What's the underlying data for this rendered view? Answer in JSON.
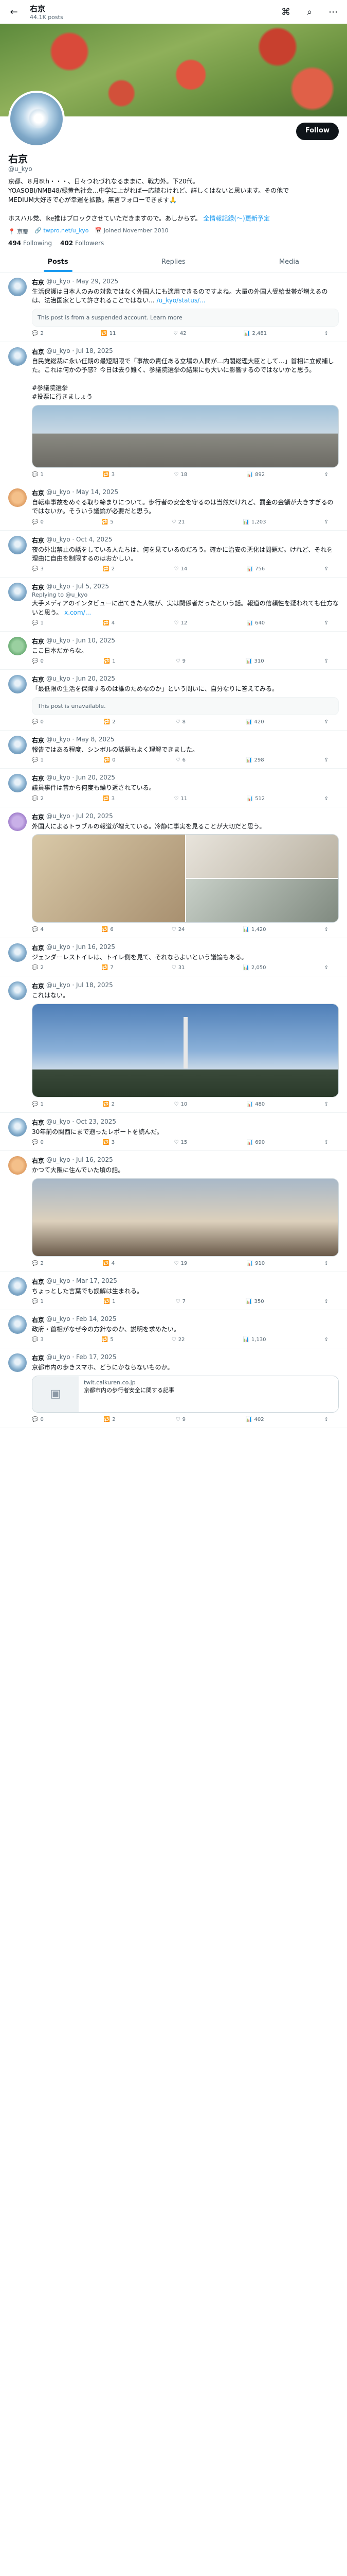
{
  "header": {
    "name": "右京",
    "post_count": "44.1K posts"
  },
  "profile": {
    "name": "右京",
    "handle": "@u_kyo",
    "follow_label": "Follow",
    "bio": "京都、８月8th・・・、日々つれづれなるままに、戦力外。下20代。\nYOASOBI/NMB48/緑黄色社会…中学に上がれば一応読むけれど、詳しくはないと思います。その他で\nMEDIUM大好きで心が幸運を拡散。無言フォローできます🙏\n\nホスハル党、Ike推はブロックさせていただきますので。あしからず。",
    "bio_link": "全情報記録(〜)更新予定",
    "location": "京都",
    "website": "twpro.net/u_kyo",
    "joined": "Joined November 2010",
    "following": "494",
    "following_label": "Following",
    "followers": "402",
    "followers_label": "Followers"
  },
  "tabs": [
    "Posts",
    "Replies",
    "Media"
  ],
  "posts": [
    {
      "name": "右京",
      "handle": "@u_kyo · May 29, 2025",
      "reply_to": "",
      "text": "生活保護は日本人のみの対象ではなく外国人にも適用できるのですよね。大量の外国人受給世帯が増えるのは、法治国家として許されることではない...",
      "link": "/u_kyo/status/...",
      "unavailable": "This post is from a suspended account. Learn more",
      "replies": "2",
      "reposts": "11",
      "likes": "42",
      "views": "2,481"
    },
    {
      "name": "右京",
      "handle": "@u_kyo · Jul 18, 2025",
      "reply_to": "",
      "text": "自民党総裁に永い任期の最短期限で「事故の責任ある立場の人間が…内閣総理大臣として…」首相に立候補した。これは何かの予感？今日は去り難く、参議院選挙の結果にも大いに影響するのではないかと思う。\n\n#参議院選挙\n#投票に行きましょう",
      "link": "",
      "unavailable": "",
      "replies": "1",
      "reposts": "3",
      "likes": "18",
      "views": "892"
    },
    {
      "name": "右京",
      "handle": "@u_kyo · May 14, 2025",
      "reply_to": "",
      "text": "自転車事故をめぐる取り締まりについて。歩行者の安全を守るのは当然だけれど、罰金の金額が大きすぎるのではないか。そういう議論が必要だと思う。",
      "link": "",
      "unavailable": "",
      "replies": "0",
      "reposts": "5",
      "likes": "21",
      "views": "1,203"
    },
    {
      "name": "右京",
      "handle": "@u_kyo · Oct 4, 2025",
      "reply_to": "",
      "text": "夜の外出禁止の話をしている人たちは、何を見ているのだろう。確かに治安の悪化は問題だ。けれど、それを理由に自由を制限するのはおかしい。",
      "link": "",
      "unavailable": "",
      "replies": "3",
      "reposts": "2",
      "likes": "14",
      "views": "756"
    },
    {
      "name": "右京",
      "handle": "@u_kyo · Jul 5, 2025",
      "reply_to": "Replying to @u_kyo",
      "text": "大手メディアのインタビューに出てきた人物が、実は関係者だったという話。報道の信頼性を疑われても仕方ないと思う。",
      "link": "x.com/...",
      "unavailable": "",
      "replies": "1",
      "reposts": "4",
      "likes": "12",
      "views": "640"
    },
    {
      "name": "右京",
      "handle": "@u_kyo · Jun 10, 2025",
      "reply_to": "",
      "text": "ここ日本だからな。",
      "link": "",
      "unavailable": "",
      "replies": "0",
      "reposts": "1",
      "likes": "9",
      "views": "310"
    },
    {
      "name": "右京",
      "handle": "@u_kyo · Jun 20, 2025",
      "reply_to": "",
      "text": "「最低限の生活を保障するのは誰のためなのか」という問いに、自分なりに答えてみる。",
      "link": "",
      "unavailable": "This post is unavailable.",
      "replies": "0",
      "reposts": "2",
      "likes": "8",
      "views": "420"
    },
    {
      "name": "右京",
      "handle": "@u_kyo · May 8, 2025",
      "reply_to": "",
      "text": "報告ではある程度、シンボルの話題もよく理解できました。",
      "link": "",
      "unavailable": "",
      "replies": "1",
      "reposts": "0",
      "likes": "6",
      "views": "298"
    },
    {
      "name": "右京",
      "handle": "@u_kyo · Jun 20, 2025",
      "reply_to": "",
      "text": "議員事件は昔から何度も繰り返されている。",
      "link": "",
      "unavailable": "",
      "replies": "2",
      "reposts": "3",
      "likes": "11",
      "views": "512"
    },
    {
      "name": "右京",
      "handle": "@u_kyo · Jul 20, 2025",
      "reply_to": "",
      "text": "外国人によるトラブルの報道が増えている。冷静に事実を見ることが大切だと思う。",
      "link": "",
      "unavailable": "",
      "replies": "4",
      "reposts": "6",
      "likes": "24",
      "views": "1,420"
    },
    {
      "name": "右京",
      "handle": "@u_kyo · Jun 16, 2025",
      "reply_to": "",
      "text": "ジェンダーレストイレは、トイレ側を見て、それならよいという議論もある。",
      "link": "",
      "unavailable": "",
      "replies": "2",
      "reposts": "7",
      "likes": "31",
      "views": "2,050"
    },
    {
      "name": "右京",
      "handle": "@u_kyo · Jul 18, 2025",
      "reply_to": "",
      "text": "これはない。",
      "link": "",
      "unavailable": "",
      "replies": "1",
      "reposts": "2",
      "likes": "10",
      "views": "480"
    },
    {
      "name": "右京",
      "handle": "@u_kyo · Oct 23, 2025",
      "reply_to": "",
      "text": "30年前の関西にまで遡ったレポートを読んだ。",
      "link": "",
      "unavailable": "",
      "replies": "0",
      "reposts": "3",
      "likes": "15",
      "views": "690"
    },
    {
      "name": "右京",
      "handle": "@u_kyo · Jul 16, 2025",
      "reply_to": "",
      "text": "かつて大阪に住んでいた頃の話。",
      "link": "",
      "unavailable": "",
      "replies": "2",
      "reposts": "4",
      "likes": "19",
      "views": "910"
    },
    {
      "name": "右京",
      "handle": "@u_kyo · Mar 17, 2025",
      "reply_to": "",
      "text": "ちょっとした言葉でも誤解は生まれる。",
      "link": "",
      "unavailable": "",
      "replies": "1",
      "reposts": "1",
      "likes": "7",
      "views": "350"
    },
    {
      "name": "右京",
      "handle": "@u_kyo · Feb 14, 2025",
      "reply_to": "",
      "text": "政府・首相がなぜ今の方針なのか、説明を求めたい。",
      "link": "",
      "unavailable": "",
      "replies": "3",
      "reposts": "5",
      "likes": "22",
      "views": "1,130"
    },
    {
      "name": "右京",
      "handle": "@u_kyo · Feb 17, 2025",
      "reply_to": "",
      "text": "京都市内の歩きスマホ、どうにかならないものか。",
      "link": "",
      "unavailable": "",
      "replies": "0",
      "reposts": "2",
      "likes": "9",
      "views": "402"
    }
  ],
  "card": {
    "domain": "twit.calkuren.co.jp",
    "title": "京都市内の歩行者安全に関する記事"
  }
}
